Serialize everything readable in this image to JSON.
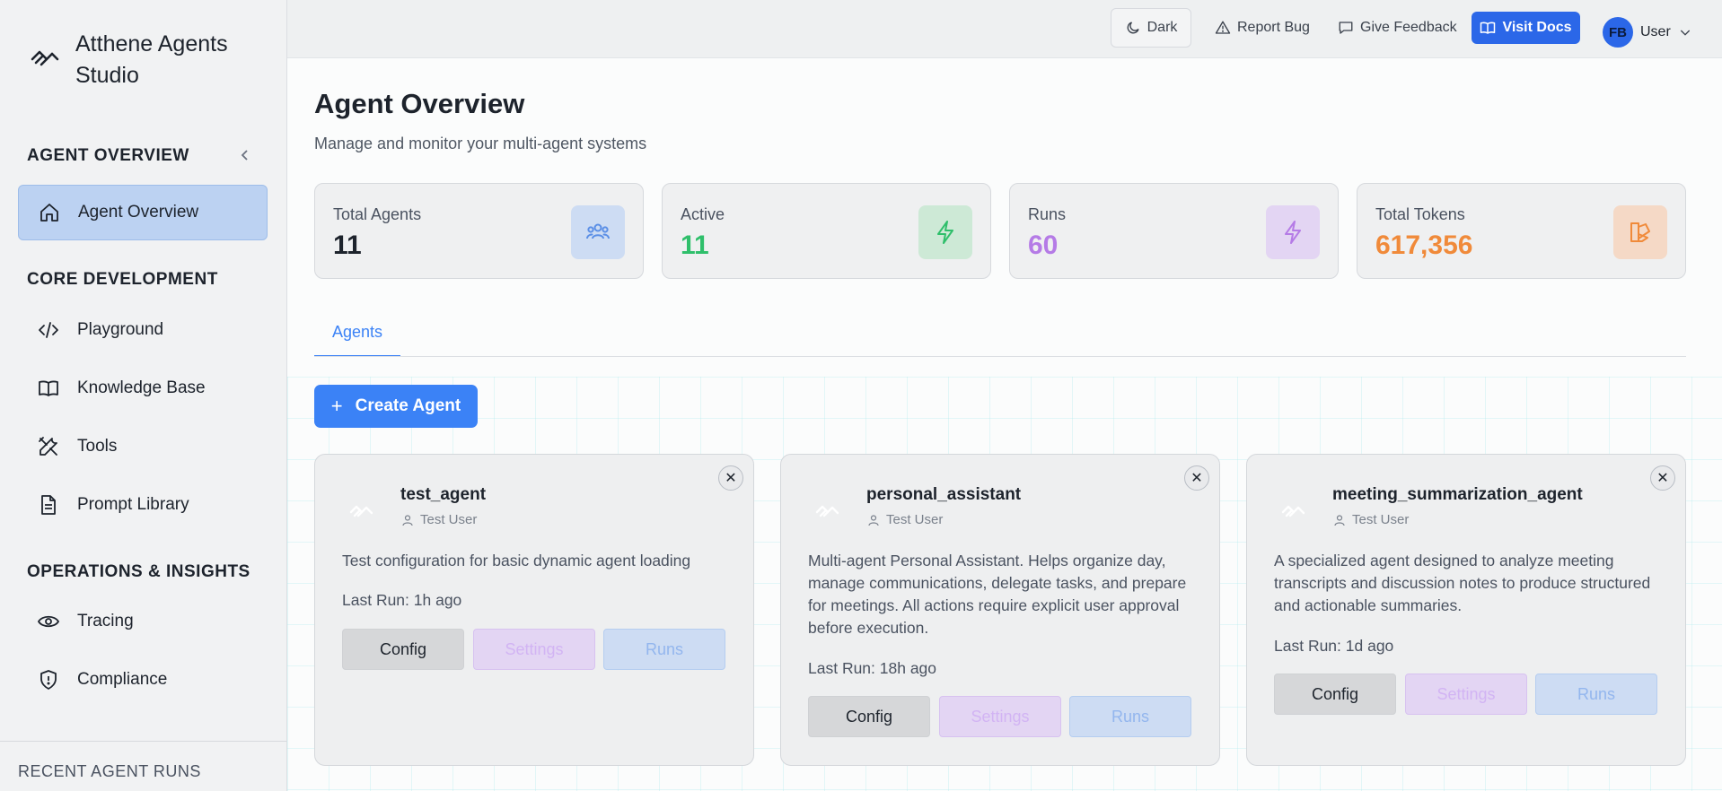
{
  "app": {
    "title": "Atthene Agents Studio"
  },
  "sidebar": {
    "section_overview": "AGENT OVERVIEW",
    "section_core": "CORE DEVELOPMENT",
    "section_ops": "OPERATIONS & INSIGHTS",
    "recent_runs": "RECENT AGENT RUNS",
    "items": [
      {
        "label": "Agent Overview",
        "icon": "home-icon",
        "active": true
      },
      {
        "label": "Playground",
        "icon": "code-icon"
      },
      {
        "label": "Knowledge Base",
        "icon": "book-icon"
      },
      {
        "label": "Tools",
        "icon": "tools-icon"
      },
      {
        "label": "Prompt Library",
        "icon": "document-icon"
      },
      {
        "label": "Tracing",
        "icon": "eye-icon"
      },
      {
        "label": "Compliance",
        "icon": "shield-icon"
      }
    ]
  },
  "topbar": {
    "dark": "Dark",
    "report_bug": "Report Bug",
    "give_feedback": "Give Feedback",
    "visit_docs": "Visit Docs",
    "user_initials": "FB",
    "user_name": "User"
  },
  "page": {
    "title": "Agent Overview",
    "subtitle": "Manage and monitor your multi-agent systems"
  },
  "stats": [
    {
      "label": "Total Agents",
      "value": "11",
      "color": "#1d232c",
      "icon": "users-icon",
      "icon_bg": "#cddcf3",
      "icon_color": "#5b8fe6"
    },
    {
      "label": "Active",
      "value": "11",
      "color": "#2fbf6b",
      "icon": "bolt-icon",
      "icon_bg": "#cde9d6",
      "icon_color": "#2fbf6b"
    },
    {
      "label": "Runs",
      "value": "60",
      "color": "#b57be6",
      "icon": "bolt-icon",
      "icon_bg": "#e3d5f3",
      "icon_color": "#b57be6"
    },
    {
      "label": "Total Tokens",
      "value": "617,356",
      "color": "#f08a3a",
      "icon": "token-icon",
      "icon_bg": "#f5d9c6",
      "icon_color": "#f08a3a"
    }
  ],
  "tabs": [
    {
      "label": "Agents",
      "active": true
    }
  ],
  "create_button": "Create Agent",
  "agent_buttons": {
    "config": "Config",
    "settings": "Settings",
    "runs": "Runs"
  },
  "agents": [
    {
      "name": "test_agent",
      "owner": "Test User",
      "description": "Test configuration for basic dynamic agent loading",
      "last_run": "Last Run: 1h ago"
    },
    {
      "name": "personal_assistant",
      "owner": "Test User",
      "description": "Multi-agent Personal Assistant. Helps organize day, manage communications, delegate tasks, and prepare for meetings. All actions require explicit user approval before execution.",
      "last_run": "Last Run: 18h ago"
    },
    {
      "name": "meeting_summarization_agent",
      "owner": "Test User",
      "description": "A specialized agent designed to analyze meeting transcripts and discussion notes to produce structured and actionable summaries.",
      "last_run": "Last Run: 1d ago"
    }
  ]
}
